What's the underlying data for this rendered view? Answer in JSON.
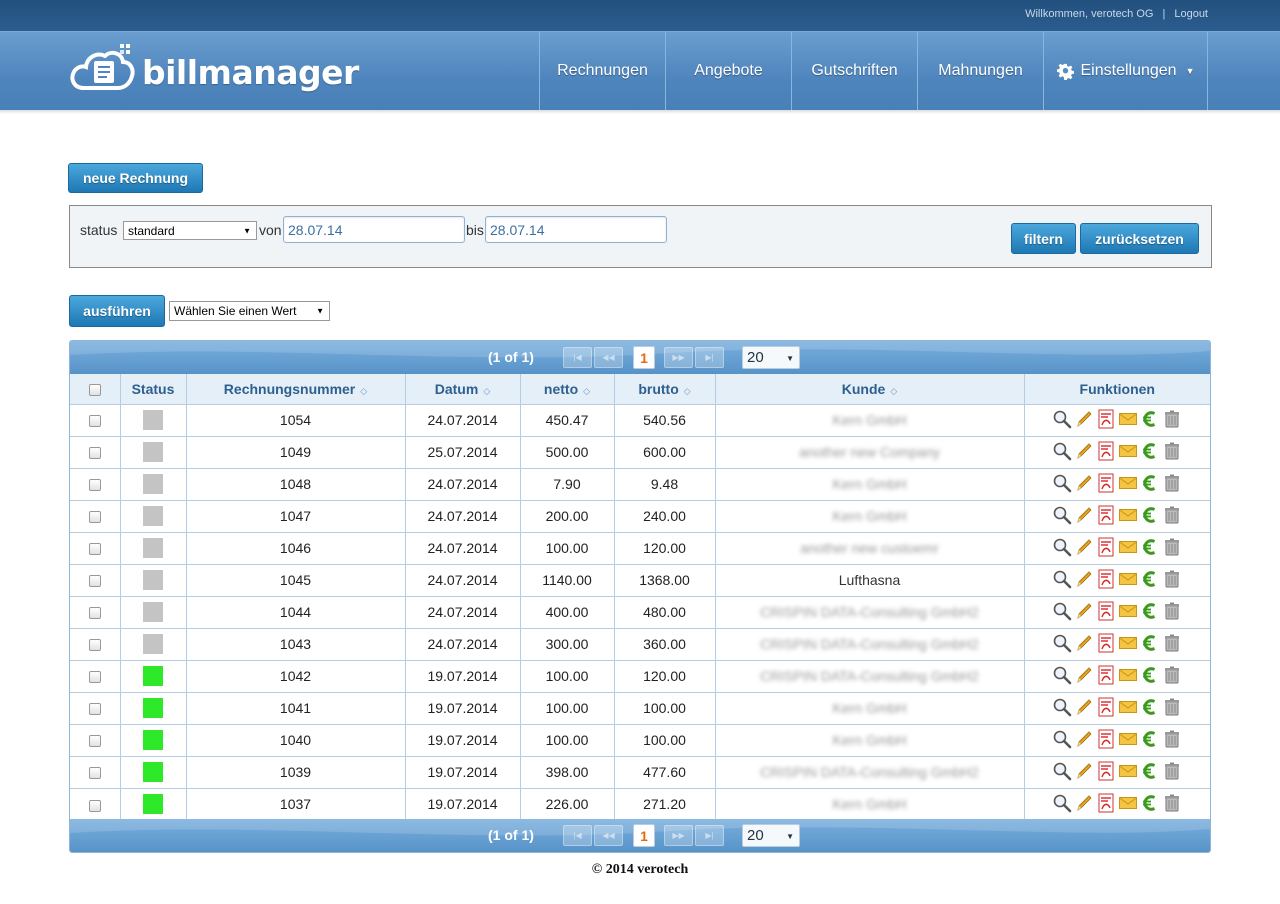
{
  "topbar": {
    "welcome": "Willkommen, verotech OG",
    "separator": "|",
    "logout": "Logout"
  },
  "brand": {
    "name": "billmanager"
  },
  "nav": [
    {
      "label": "Rechnungen"
    },
    {
      "label": "Angebote"
    },
    {
      "label": "Gutschriften"
    },
    {
      "label": "Mahnungen"
    },
    {
      "label": "Einstellungen"
    }
  ],
  "actions": {
    "new_invoice": "neue Rechnung",
    "execute": "ausführen"
  },
  "filter": {
    "status_label": "status",
    "status_value": "standard",
    "from_label": "von",
    "from_value": "28.07.14",
    "to_label": "bis",
    "to_value": "28.07.14",
    "filter_button": "filtern",
    "reset_button": "zurücksetzen"
  },
  "bulk": {
    "select_value": "Wählen Sie einen Wert"
  },
  "pager": {
    "info": "(1 of 1)",
    "current_page": "1",
    "page_size": "20"
  },
  "columns": [
    "Status",
    "Rechnungsnummer",
    "Datum",
    "netto",
    "brutto",
    "Kunde",
    "Funktionen"
  ],
  "status_colors": {
    "open": "#c4c4c4",
    "paid": "#2ee82a"
  },
  "rows": [
    {
      "status": "open",
      "number": "1054",
      "date": "24.07.2014",
      "net": "450.47",
      "gross": "540.56",
      "customer": "Kern GmbH"
    },
    {
      "status": "open",
      "number": "1049",
      "date": "25.07.2014",
      "net": "500.00",
      "gross": "600.00",
      "customer": "another new Company"
    },
    {
      "status": "open",
      "number": "1048",
      "date": "24.07.2014",
      "net": "7.90",
      "gross": "9.48",
      "customer": "Kern GmbH"
    },
    {
      "status": "open",
      "number": "1047",
      "date": "24.07.2014",
      "net": "200.00",
      "gross": "240.00",
      "customer": "Kern GmbH"
    },
    {
      "status": "open",
      "number": "1046",
      "date": "24.07.2014",
      "net": "100.00",
      "gross": "120.00",
      "customer": "another new custoemr"
    },
    {
      "status": "open",
      "number": "1045",
      "date": "24.07.2014",
      "net": "1140.00",
      "gross": "1368.00",
      "customer": "Lufthasna",
      "clear": true
    },
    {
      "status": "open",
      "number": "1044",
      "date": "24.07.2014",
      "net": "400.00",
      "gross": "480.00",
      "customer": "CRISPIN DATA-Consulting GmbH2"
    },
    {
      "status": "open",
      "number": "1043",
      "date": "24.07.2014",
      "net": "300.00",
      "gross": "360.00",
      "customer": "CRISPIN DATA-Consulting GmbH2"
    },
    {
      "status": "paid",
      "number": "1042",
      "date": "19.07.2014",
      "net": "100.00",
      "gross": "120.00",
      "customer": "CRISPIN DATA-Consulting GmbH2"
    },
    {
      "status": "paid",
      "number": "1041",
      "date": "19.07.2014",
      "net": "100.00",
      "gross": "100.00",
      "customer": "Kern GmbH"
    },
    {
      "status": "paid",
      "number": "1040",
      "date": "19.07.2014",
      "net": "100.00",
      "gross": "100.00",
      "customer": "Kern GmbH"
    },
    {
      "status": "paid",
      "number": "1039",
      "date": "19.07.2014",
      "net": "398.00",
      "gross": "477.60",
      "customer": "CRISPIN DATA-Consulting GmbH2"
    },
    {
      "status": "paid",
      "number": "1037",
      "date": "19.07.2014",
      "net": "226.00",
      "gross": "271.20",
      "customer": "Kern GmbH"
    }
  ],
  "row_functions": [
    "view-icon",
    "edit-icon",
    "pdf-icon",
    "email-icon",
    "payment-icon",
    "delete-icon"
  ],
  "footer": {
    "copyright": "© 2014 verotech"
  }
}
